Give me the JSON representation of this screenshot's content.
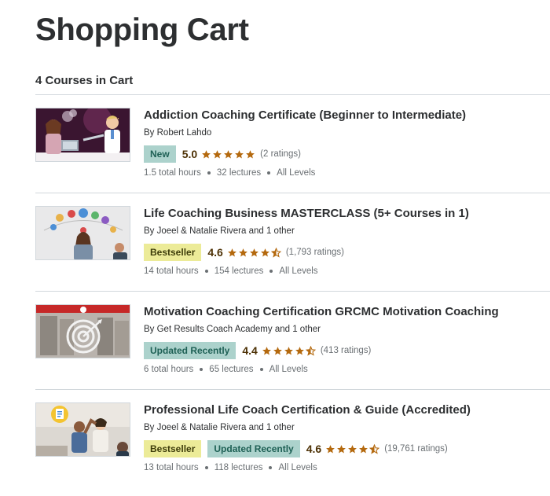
{
  "page_title": "Shopping Cart",
  "cart_count_label": "4 Courses in Cart",
  "colors": {
    "star": "#b4690e",
    "badge_new_bg": "#acd2cc",
    "badge_bestseller_bg": "#eceb98",
    "divider": "#d1d7dc"
  },
  "courses": [
    {
      "title": "Addiction Coaching Certificate (Beginner to Intermediate)",
      "instructor": "By Robert Lahdo",
      "badges": [
        "New"
      ],
      "rating": "5.0",
      "stars": 5,
      "ratings_count": "(2 ratings)",
      "hours": "1.5 total hours",
      "lectures": "32 lectures",
      "level": "All Levels",
      "thumbnail_icon": "addiction-coaching-illustration"
    },
    {
      "title": "Life Coaching Business MASTERCLASS (5+ Courses in 1)",
      "instructor": "By Joeel & Natalie Rivera and 1 other",
      "badges": [
        "Bestseller"
      ],
      "rating": "4.6",
      "stars": 4.5,
      "ratings_count": "(1,793 ratings)",
      "hours": "14 total hours",
      "lectures": "154 lectures",
      "level": "All Levels",
      "thumbnail_icon": "life-coaching-business-image"
    },
    {
      "title": "Motivation Coaching Certification GRCMC Motivation Coaching",
      "instructor": "By Get Results Coach Academy and 1 other",
      "badges": [
        "Updated Recently"
      ],
      "rating": "4.4",
      "stars": 4.5,
      "ratings_count": "(413 ratings)",
      "hours": "6 total hours",
      "lectures": "65 lectures",
      "level": "All Levels",
      "thumbnail_icon": "motivation-target-image"
    },
    {
      "title": "Professional Life Coach Certification & Guide (Accredited)",
      "instructor": "By Joeel & Natalie Rivera and 1 other",
      "badges": [
        "Bestseller",
        "Updated Recently"
      ],
      "rating": "4.6",
      "stars": 4.5,
      "ratings_count": "(19,761 ratings)",
      "hours": "13 total hours",
      "lectures": "118 lectures",
      "level": "All Levels",
      "thumbnail_icon": "professional-coach-image"
    }
  ]
}
